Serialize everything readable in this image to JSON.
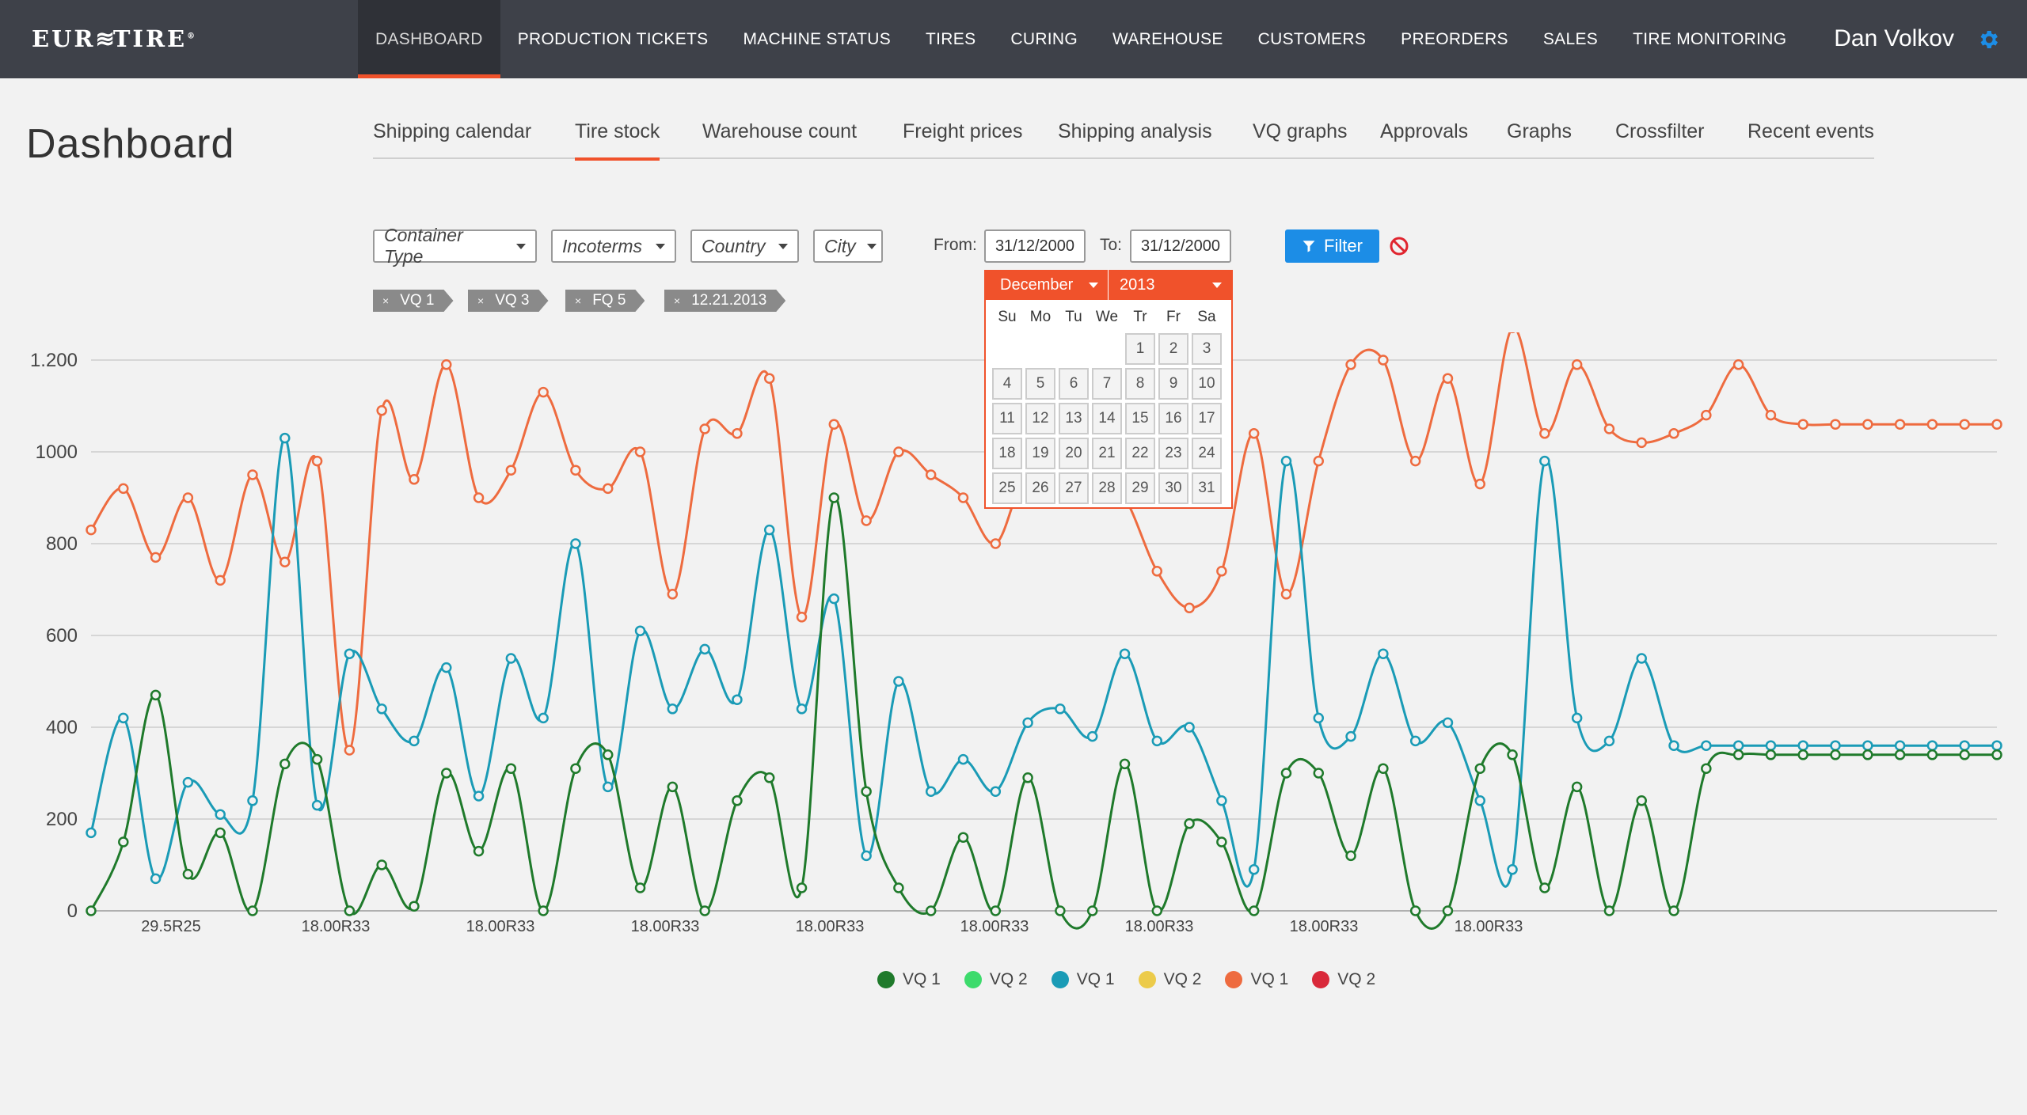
{
  "app": {
    "logo": "EURTIRE",
    "user_name": "Dan Volkov",
    "nav": [
      {
        "label": "DASHBOARD",
        "active": true
      },
      {
        "label": "PRODUCTION TICKETS"
      },
      {
        "label": "MACHINE STATUS"
      },
      {
        "label": "TIRES"
      },
      {
        "label": "CURING"
      },
      {
        "label": "WAREHOUSE"
      },
      {
        "label": "CUSTOMERS"
      },
      {
        "label": "PREORDERS"
      },
      {
        "label": "SALES"
      },
      {
        "label": "TIRE MONITORING"
      }
    ]
  },
  "page": {
    "title": "Dashboard",
    "subtabs": [
      {
        "label": "Shipping calendar"
      },
      {
        "label": "Tire stock",
        "active": true
      },
      {
        "label": "Warehouse count"
      },
      {
        "label": "Freight prices"
      },
      {
        "label": "Shipping analysis"
      },
      {
        "label": "VQ graphs"
      },
      {
        "label": "Approvals"
      },
      {
        "label": "Graphs"
      },
      {
        "label": "Crossfilter"
      },
      {
        "label": "Recent events"
      }
    ]
  },
  "filters": {
    "container_type": "Container Type",
    "incoterms": "Incoterms",
    "country": "Country",
    "city": "City",
    "from_label": "From:",
    "from_value": "31/12/2000",
    "to_label": "To:",
    "to_value": "31/12/2000",
    "filter_button": "Filter",
    "tags": [
      "VQ 1",
      "VQ 3",
      "FQ 5",
      "12.21.2013"
    ],
    "tag_remove": "×"
  },
  "datepicker": {
    "month": "December",
    "year": "2013",
    "weekdays": [
      "Su",
      "Mo",
      "Tu",
      "We",
      "Tr",
      "Fr",
      "Sa"
    ],
    "first_weekday_index": 4,
    "days": [
      "1",
      "2",
      "3",
      "4",
      "5",
      "6",
      "7",
      "8",
      "9",
      "10",
      "11",
      "12",
      "13",
      "14",
      "15",
      "16",
      "17",
      "18",
      "19",
      "20",
      "21",
      "22",
      "23",
      "24",
      "25",
      "26",
      "27",
      "28",
      "29",
      "30",
      "31"
    ]
  },
  "legend": [
    {
      "label": "VQ 1",
      "color": "#1f7a2b"
    },
    {
      "label": "VQ 2",
      "color": "#3ddb6c"
    },
    {
      "label": "VQ 1",
      "color": "#1a9bb6"
    },
    {
      "label": "VQ 2",
      "color": "#eccb4a"
    },
    {
      "label": "VQ 1",
      "color": "#ee6b3f"
    },
    {
      "label": "VQ 2",
      "color": "#d9293a"
    }
  ],
  "chart_data": {
    "type": "line",
    "ylim": [
      0,
      1200
    ],
    "y_ticks": [
      "0",
      "200",
      "400",
      "600",
      "800",
      "1000",
      "1.200"
    ],
    "x_ticks": [
      "29.5R25",
      "18.00R33",
      "18.00R33",
      "18.00R33",
      "18.00R33",
      "18.00R33",
      "18.00R33",
      "18.00R33",
      "18.00R33"
    ],
    "x": [
      0,
      1,
      2,
      3,
      4,
      5,
      6,
      7,
      8,
      9,
      10,
      11,
      12,
      13,
      14,
      15,
      16,
      17,
      18,
      19,
      20,
      21,
      22,
      23,
      24,
      25,
      26,
      27,
      28,
      29,
      30,
      31,
      32,
      33,
      34,
      35,
      36,
      37,
      38,
      39,
      40,
      41,
      42,
      43,
      44,
      45,
      46,
      47,
      48,
      49,
      50,
      51,
      52,
      53,
      54,
      55,
      56,
      57,
      58,
      59
    ],
    "series": [
      {
        "color": "#ee6b3f",
        "values": [
          830,
          920,
          770,
          900,
          720,
          950,
          760,
          980,
          350,
          1090,
          940,
          1190,
          900,
          960,
          1130,
          960,
          920,
          1000,
          690,
          1050,
          1040,
          1160,
          640,
          1060,
          850,
          1000,
          950,
          900,
          800,
          960,
          890,
          960,
          900,
          740,
          660,
          740,
          1040,
          690,
          980,
          1190,
          1200,
          980,
          1160,
          930,
          1270,
          1040,
          1190,
          1050,
          1020,
          1040,
          1080,
          1190,
          1080,
          1060,
          1060,
          1060,
          1060,
          1060,
          1060,
          1060
        ]
      },
      {
        "color": "#1a9bb6",
        "values": [
          170,
          420,
          70,
          280,
          210,
          240,
          1030,
          230,
          560,
          440,
          370,
          530,
          250,
          550,
          420,
          800,
          270,
          610,
          440,
          570,
          460,
          830,
          440,
          680,
          120,
          500,
          260,
          330,
          260,
          410,
          440,
          380,
          560,
          370,
          400,
          240,
          90,
          980,
          420,
          380,
          560,
          370,
          410,
          240,
          90,
          980,
          420,
          370,
          550,
          360,
          360,
          360,
          360,
          360,
          360,
          360,
          360,
          360,
          360,
          360
        ]
      },
      {
        "color": "#1f7a2b",
        "values": [
          0,
          150,
          470,
          80,
          170,
          0,
          320,
          330,
          0,
          100,
          10,
          300,
          130,
          310,
          0,
          310,
          340,
          50,
          270,
          0,
          240,
          290,
          50,
          900,
          260,
          50,
          0,
          160,
          0,
          290,
          0,
          0,
          320,
          0,
          190,
          150,
          0,
          300,
          300,
          120,
          310,
          0,
          0,
          310,
          340,
          50,
          270,
          0,
          240,
          0,
          310,
          340,
          340,
          340,
          340,
          340,
          340,
          340,
          340,
          340
        ]
      }
    ]
  }
}
